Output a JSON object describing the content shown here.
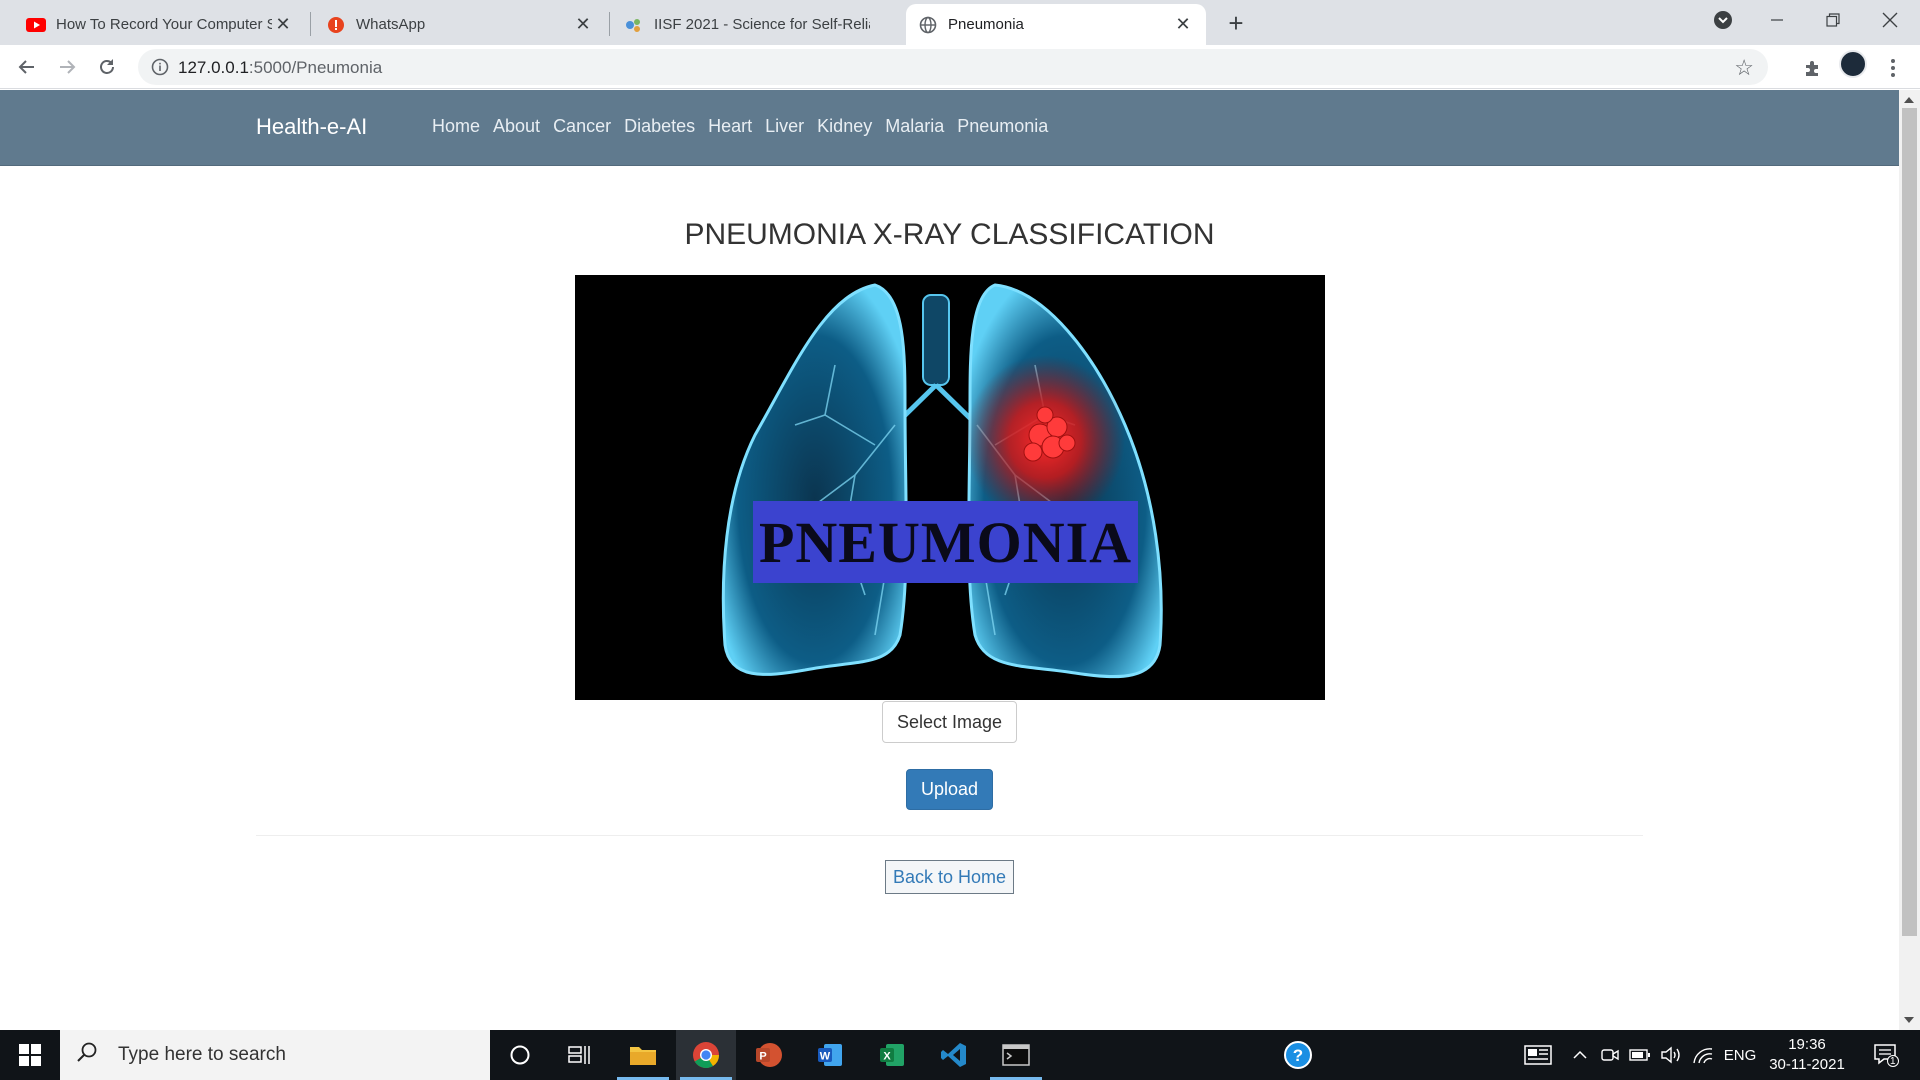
{
  "browser": {
    "tabs": [
      {
        "title": "How To Record Your Computer S",
        "icon": "youtube-icon",
        "active": false
      },
      {
        "title": "WhatsApp",
        "icon": "whatsapp-alert-icon",
        "active": false
      },
      {
        "title": "IISF 2021 - Science for Self-Relian",
        "icon": "iisf-icon",
        "active": false
      },
      {
        "title": "Pneumonia",
        "icon": "globe-icon",
        "active": true
      }
    ],
    "url_host": "127.0.0.1",
    "url_path": ":5000/Pneumonia"
  },
  "navbar": {
    "brand": "Health-e-AI",
    "links": [
      "Home",
      "About",
      "Cancer",
      "Diabetes",
      "Heart",
      "Liver",
      "Kidney",
      "Malaria",
      "Pneumonia"
    ]
  },
  "main": {
    "title": "PNEUMONIA X-RAY CLASSIFICATION",
    "hero_label": "PNEUMONIA",
    "select_label": "Select Image",
    "upload_label": "Upload",
    "back_label": "Back to Home"
  },
  "taskbar": {
    "search_placeholder": "Type here to search",
    "language": "ENG",
    "time": "19:36",
    "date": "30-11-2021",
    "notification_count": "1"
  },
  "colors": {
    "navbar": "#607a8e",
    "primary": "#337ab7",
    "hero_label_bg": "#3b43cf"
  }
}
